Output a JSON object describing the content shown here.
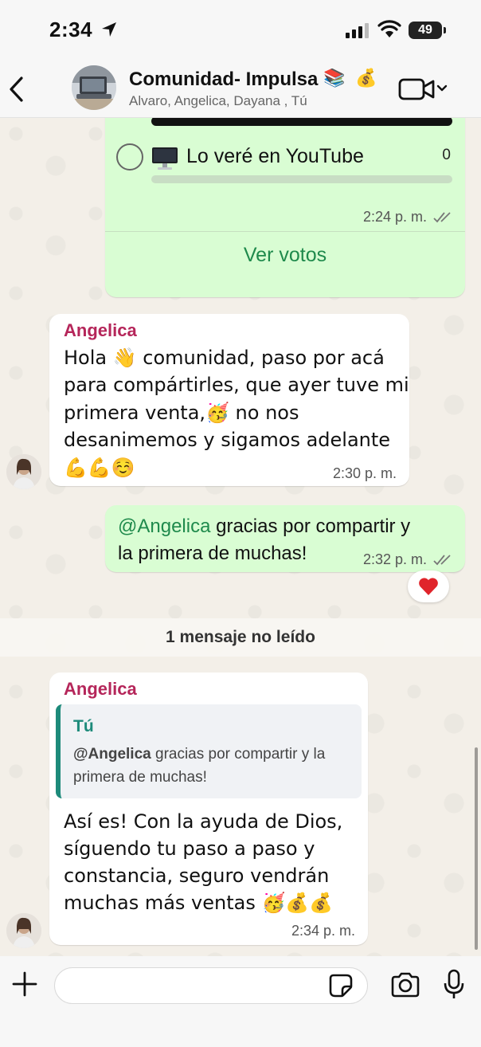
{
  "status_bar": {
    "time": "2:34",
    "battery": "49"
  },
  "header": {
    "title": "Comunidad- Impulsa",
    "title_emojis": [
      "📚",
      "💰"
    ],
    "subtitle": "Alvaro, Angelica, Dayana , Tú"
  },
  "poll": {
    "option_label": "Lo veré en YouTube",
    "option_emoji": "🖥️",
    "option_votes": "0",
    "votes_fraction": 0,
    "time": "2:24 p. m.",
    "view_votes": "Ver votos"
  },
  "messages": [
    {
      "sender": "Angelica",
      "lines": [
        "Hola 👋 comunidad, paso por acá",
        "para compártirles, que ayer tuve mi",
        "primera venta,🥳 no nos",
        "desanimemos y sigamos adelante",
        "💪💪☺️"
      ],
      "time": "2:30 p. m."
    },
    {
      "mention": "@Angelica",
      "line1_rest": " gracias por compartir y",
      "line2": "la primera de muchas!",
      "time": "2:32 p. m.",
      "reaction": "❤️"
    },
    {
      "sender": "Angelica",
      "quote_author": "Tú",
      "quote_mention": "@Angelica",
      "quote_line1_rest": " gracias por compartir y la",
      "quote_line2": "primera de muchas!",
      "lines": [
        "Así es! Con la ayuda de Dios,",
        "síguendo tu paso a paso y",
        "constancia, seguro vendrán",
        "muchas más ventas 🥳💰💰"
      ],
      "time": "2:34 p. m."
    }
  ],
  "unread_label": "1 mensaje no leído",
  "input": {
    "value": "",
    "placeholder": ""
  },
  "icons": {
    "back": "chevron-left-icon",
    "video": "video-camera-icon",
    "plus": "plus-icon",
    "sticker": "sticker-icon",
    "camera": "camera-icon",
    "mic": "microphone-icon"
  },
  "colors": {
    "outgoing_bubble": "#d9fdd3",
    "incoming_bubble": "#ffffff",
    "sender_name": "#b5265a",
    "mention": "#1f8a4c",
    "quote_accent": "#1d8a7a"
  }
}
